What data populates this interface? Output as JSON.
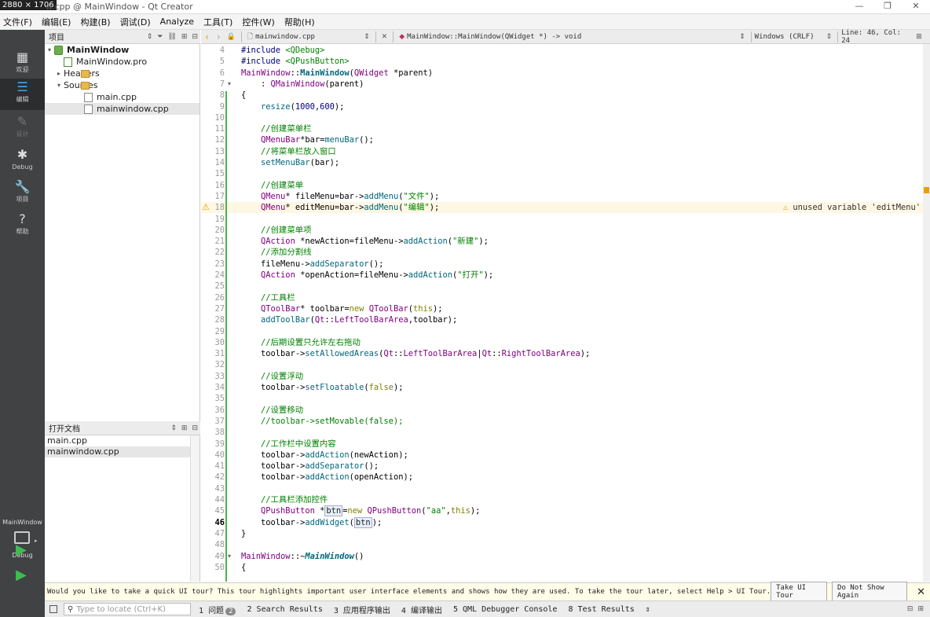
{
  "window": {
    "badge": "2880 × 1706",
    "title": "w.cpp @ MainWindow - Qt Creator",
    "controls": [
      "—",
      "❐",
      "✕"
    ]
  },
  "menubar": [
    "文件(F)",
    "编辑(E)",
    "构建(B)",
    "调试(D)",
    "Analyze",
    "工具(T)",
    "控件(W)",
    "帮助(H)"
  ],
  "modes": [
    {
      "label": "欢迎",
      "icon": "▦"
    },
    {
      "label": "编辑",
      "icon": "☰"
    },
    {
      "label": "设计",
      "icon": "✎"
    },
    {
      "label": "Debug",
      "icon": "✱"
    },
    {
      "label": "项目",
      "icon": "🔧"
    },
    {
      "label": "帮助",
      "icon": "?"
    }
  ],
  "kit": {
    "name": "MainWindow",
    "config": "Debug"
  },
  "project_panel": {
    "title": "项目",
    "tree": [
      "MainWindow",
      "MainWindow.pro",
      "Headers",
      "Sources",
      "main.cpp",
      "mainwindow.cpp"
    ]
  },
  "open_docs": {
    "title": "打开文档",
    "items": [
      "main.cpp",
      "mainwindow.cpp"
    ]
  },
  "editor_toolbar": {
    "file": "mainwindow.cpp",
    "symbol": "MainWindow::MainWindow(QWidget *) -> void",
    "encoding": "Windows (CRLF)",
    "position": "Line: 46, Col: 24"
  },
  "editor": {
    "current_line": 46,
    "warning": {
      "line": 18,
      "text": "unused variable 'editMenu'"
    },
    "lines": [
      {
        "n": 4,
        "t": [
          [
            "#include ",
            "pp"
          ],
          [
            "<QDebug>",
            "inc"
          ]
        ]
      },
      {
        "n": 5,
        "t": [
          [
            "#include ",
            "pp"
          ],
          [
            "<QPushButton>",
            "inc"
          ]
        ]
      },
      {
        "n": 6,
        "t": [
          [
            "MainWindow",
            "type"
          ],
          [
            "::",
            "p"
          ],
          [
            "MainWindow",
            "fnb"
          ],
          [
            "(",
            "p"
          ],
          [
            "QWidget",
            "type"
          ],
          [
            " *parent)",
            "p"
          ]
        ]
      },
      {
        "n": 7,
        "t": [
          [
            "    : ",
            "p"
          ],
          [
            "QMainWindow",
            "type"
          ],
          [
            "(parent)",
            "p"
          ]
        ]
      },
      {
        "n": 8,
        "t": [
          [
            "{",
            "p"
          ]
        ]
      },
      {
        "n": 9,
        "t": [
          [
            "    ",
            "p"
          ],
          [
            "resize",
            "fn"
          ],
          [
            "(",
            "p"
          ],
          [
            "1000",
            "num"
          ],
          [
            ",",
            "p"
          ],
          [
            "600",
            "num"
          ],
          [
            ");",
            "p"
          ]
        ]
      },
      {
        "n": 10,
        "t": []
      },
      {
        "n": 11,
        "t": [
          [
            "    //创建菜单栏",
            "cm"
          ]
        ]
      },
      {
        "n": 12,
        "t": [
          [
            "    ",
            "p"
          ],
          [
            "QMenuBar",
            "type"
          ],
          [
            "*bar=",
            "p"
          ],
          [
            "menuBar",
            "fn"
          ],
          [
            "();",
            "p"
          ]
        ]
      },
      {
        "n": 13,
        "t": [
          [
            "    //将菜单栏放入窗口",
            "cm"
          ]
        ]
      },
      {
        "n": 14,
        "t": [
          [
            "    ",
            "p"
          ],
          [
            "setMenuBar",
            "fn"
          ],
          [
            "(bar);",
            "p"
          ]
        ]
      },
      {
        "n": 15,
        "t": []
      },
      {
        "n": 16,
        "t": [
          [
            "    //创建菜单",
            "cm"
          ]
        ]
      },
      {
        "n": 17,
        "t": [
          [
            "    ",
            "p"
          ],
          [
            "QMenu",
            "type"
          ],
          [
            "* fileMenu=bar->",
            "p"
          ],
          [
            "addMenu",
            "fn"
          ],
          [
            "(",
            "p"
          ],
          [
            "\"文件\"",
            "str"
          ],
          [
            ");",
            "p"
          ]
        ]
      },
      {
        "n": 18,
        "t": [
          [
            "    ",
            "p"
          ],
          [
            "QMenu",
            "type"
          ],
          [
            "* editMenu=bar->",
            "p"
          ],
          [
            "addMenu",
            "fn"
          ],
          [
            "(",
            "p"
          ],
          [
            "\"编辑\"",
            "str"
          ],
          [
            ");",
            "p"
          ]
        ]
      },
      {
        "n": 19,
        "t": []
      },
      {
        "n": 20,
        "t": [
          [
            "    //创建菜单项",
            "cm"
          ]
        ]
      },
      {
        "n": 21,
        "t": [
          [
            "    ",
            "p"
          ],
          [
            "QAction",
            "type"
          ],
          [
            " *newAction=fileMenu->",
            "p"
          ],
          [
            "addAction",
            "fn"
          ],
          [
            "(",
            "p"
          ],
          [
            "\"新建\"",
            "str"
          ],
          [
            ");",
            "p"
          ]
        ]
      },
      {
        "n": 22,
        "t": [
          [
            "    //添加分割线",
            "cm"
          ]
        ]
      },
      {
        "n": 23,
        "t": [
          [
            "    fileMenu->",
            "p"
          ],
          [
            "addSeparator",
            "fn"
          ],
          [
            "();",
            "p"
          ]
        ]
      },
      {
        "n": 24,
        "t": [
          [
            "    ",
            "p"
          ],
          [
            "QAction",
            "type"
          ],
          [
            " *openAction=fileMenu->",
            "p"
          ],
          [
            "addAction",
            "fn"
          ],
          [
            "(",
            "p"
          ],
          [
            "\"打开\"",
            "str"
          ],
          [
            ");",
            "p"
          ]
        ]
      },
      {
        "n": 25,
        "t": []
      },
      {
        "n": 26,
        "t": [
          [
            "    //工具栏",
            "cm"
          ]
        ]
      },
      {
        "n": 27,
        "t": [
          [
            "    ",
            "p"
          ],
          [
            "QToolBar",
            "type"
          ],
          [
            "* toolbar=",
            "p"
          ],
          [
            "new",
            "kw"
          ],
          [
            " ",
            "p"
          ],
          [
            "QToolBar",
            "type"
          ],
          [
            "(",
            "p"
          ],
          [
            "this",
            "kw"
          ],
          [
            ");",
            "p"
          ]
        ]
      },
      {
        "n": 28,
        "t": [
          [
            "    ",
            "p"
          ],
          [
            "addToolBar",
            "fn"
          ],
          [
            "(",
            "p"
          ],
          [
            "Qt",
            "type"
          ],
          [
            "::",
            "p"
          ],
          [
            "LeftToolBarArea",
            "enum"
          ],
          [
            ",toolbar);",
            "p"
          ]
        ]
      },
      {
        "n": 29,
        "t": []
      },
      {
        "n": 30,
        "t": [
          [
            "    //后期设置只允许左右拖动",
            "cm"
          ]
        ]
      },
      {
        "n": 31,
        "t": [
          [
            "    toolbar->",
            "p"
          ],
          [
            "setAllowedAreas",
            "fn"
          ],
          [
            "(",
            "p"
          ],
          [
            "Qt",
            "type"
          ],
          [
            "::",
            "p"
          ],
          [
            "LeftToolBarArea",
            "enum"
          ],
          [
            "|",
            "p"
          ],
          [
            "Qt",
            "type"
          ],
          [
            "::",
            "p"
          ],
          [
            "RightToolBarArea",
            "enum"
          ],
          [
            ");",
            "p"
          ]
        ]
      },
      {
        "n": 32,
        "t": []
      },
      {
        "n": 33,
        "t": [
          [
            "    //设置浮动",
            "cm"
          ]
        ]
      },
      {
        "n": 34,
        "t": [
          [
            "    toolbar->",
            "p"
          ],
          [
            "setFloatable",
            "fn"
          ],
          [
            "(",
            "p"
          ],
          [
            "false",
            "kw"
          ],
          [
            ");",
            "p"
          ]
        ]
      },
      {
        "n": 35,
        "t": []
      },
      {
        "n": 36,
        "t": [
          [
            "    //设置移动",
            "cm"
          ]
        ]
      },
      {
        "n": 37,
        "t": [
          [
            "    //toolbar->setMovable(false);",
            "cm"
          ]
        ]
      },
      {
        "n": 38,
        "t": []
      },
      {
        "n": 39,
        "t": [
          [
            "    //工作栏中设置内容",
            "cm"
          ]
        ]
      },
      {
        "n": 40,
        "t": [
          [
            "    toolbar->",
            "p"
          ],
          [
            "addAction",
            "fn"
          ],
          [
            "(newAction);",
            "p"
          ]
        ]
      },
      {
        "n": 41,
        "t": [
          [
            "    toolbar->",
            "p"
          ],
          [
            "addSeparator",
            "fn"
          ],
          [
            "();",
            "p"
          ]
        ]
      },
      {
        "n": 42,
        "t": [
          [
            "    toolbar->",
            "p"
          ],
          [
            "addAction",
            "fn"
          ],
          [
            "(openAction);",
            "p"
          ]
        ]
      },
      {
        "n": 43,
        "t": []
      },
      {
        "n": 44,
        "t": [
          [
            "    //工具栏添加控件",
            "cm"
          ]
        ]
      },
      {
        "n": 45,
        "t": [
          [
            "    ",
            "p"
          ],
          [
            "QPushButton",
            "type"
          ],
          [
            " *",
            "p"
          ],
          [
            "btn",
            "hl"
          ],
          [
            "=",
            "p"
          ],
          [
            "new",
            "kw"
          ],
          [
            " ",
            "p"
          ],
          [
            "QPushButton",
            "type"
          ],
          [
            "(",
            "p"
          ],
          [
            "\"aa\"",
            "str"
          ],
          [
            ",",
            "p"
          ],
          [
            "this",
            "kw"
          ],
          [
            ");",
            "p"
          ]
        ]
      },
      {
        "n": 46,
        "t": [
          [
            "    toolbar->",
            "p"
          ],
          [
            "addWidget",
            "fn"
          ],
          [
            "(",
            "p"
          ],
          [
            "btn",
            "hl"
          ],
          [
            ");",
            "p"
          ]
        ]
      },
      {
        "n": 47,
        "t": [
          [
            "}",
            "p"
          ]
        ]
      },
      {
        "n": 48,
        "t": []
      },
      {
        "n": 49,
        "t": [
          [
            "MainWindow",
            "type"
          ],
          [
            "::~",
            "p"
          ],
          [
            "MainWindow",
            "fnbi"
          ],
          [
            "()",
            "p"
          ]
        ]
      },
      {
        "n": 50,
        "t": [
          [
            "{",
            "p"
          ]
        ]
      }
    ]
  },
  "tour": {
    "text": "Would you like to take a quick UI tour? This tour highlights important user interface elements and shows how they are used. To take the tour later, select Help > UI Tour.",
    "take_button": "Take UI Tour",
    "dismiss_button": "Do Not Show Again"
  },
  "statusbar": {
    "locate_placeholder": "Type to locate (Ctrl+K)",
    "panes": [
      {
        "num": "1",
        "label": "问题",
        "badge": "2"
      },
      {
        "num": "2",
        "label": "Search Results"
      },
      {
        "num": "3",
        "label": "应用程序输出"
      },
      {
        "num": "4",
        "label": "编译输出"
      },
      {
        "num": "5",
        "label": "QML Debugger Console"
      },
      {
        "num": "8",
        "label": "Test Results"
      }
    ]
  },
  "colors": {
    "accent": "#4aa3e6",
    "warning": "#e8a000",
    "modebar": "#404244",
    "run": "#3ebd4f"
  }
}
